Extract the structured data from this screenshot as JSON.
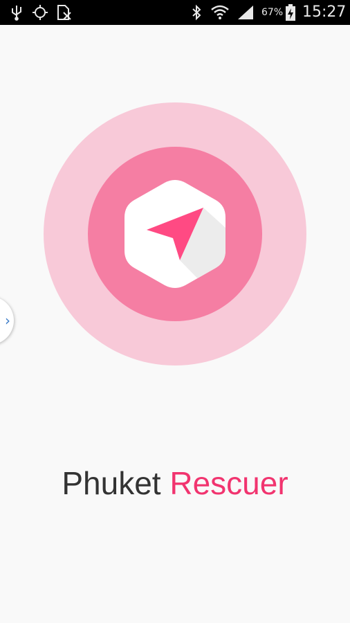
{
  "status_bar": {
    "left_icons": [
      "usb-icon",
      "gps-icon",
      "no-sim-icon"
    ],
    "right_icons": [
      "bluetooth-icon",
      "wifi-icon",
      "signal-icon",
      "battery-charging-icon"
    ],
    "battery_percent": "67%",
    "time": "15:27"
  },
  "side_tab": {
    "icon": "chevron-right-icon"
  },
  "logo": {
    "icon": "navigation-arrow-icon",
    "colors": {
      "outer_ring": "#f8c9d8",
      "inner_ring": "#f57ea3",
      "badge": "#ffffff",
      "arrow": "#ff4a83"
    }
  },
  "title": {
    "word1": "Phuket",
    "word2": "Rescuer"
  },
  "colors": {
    "title_primary": "#333333",
    "title_accent": "#f1346f",
    "background": "#f9f9f9"
  }
}
